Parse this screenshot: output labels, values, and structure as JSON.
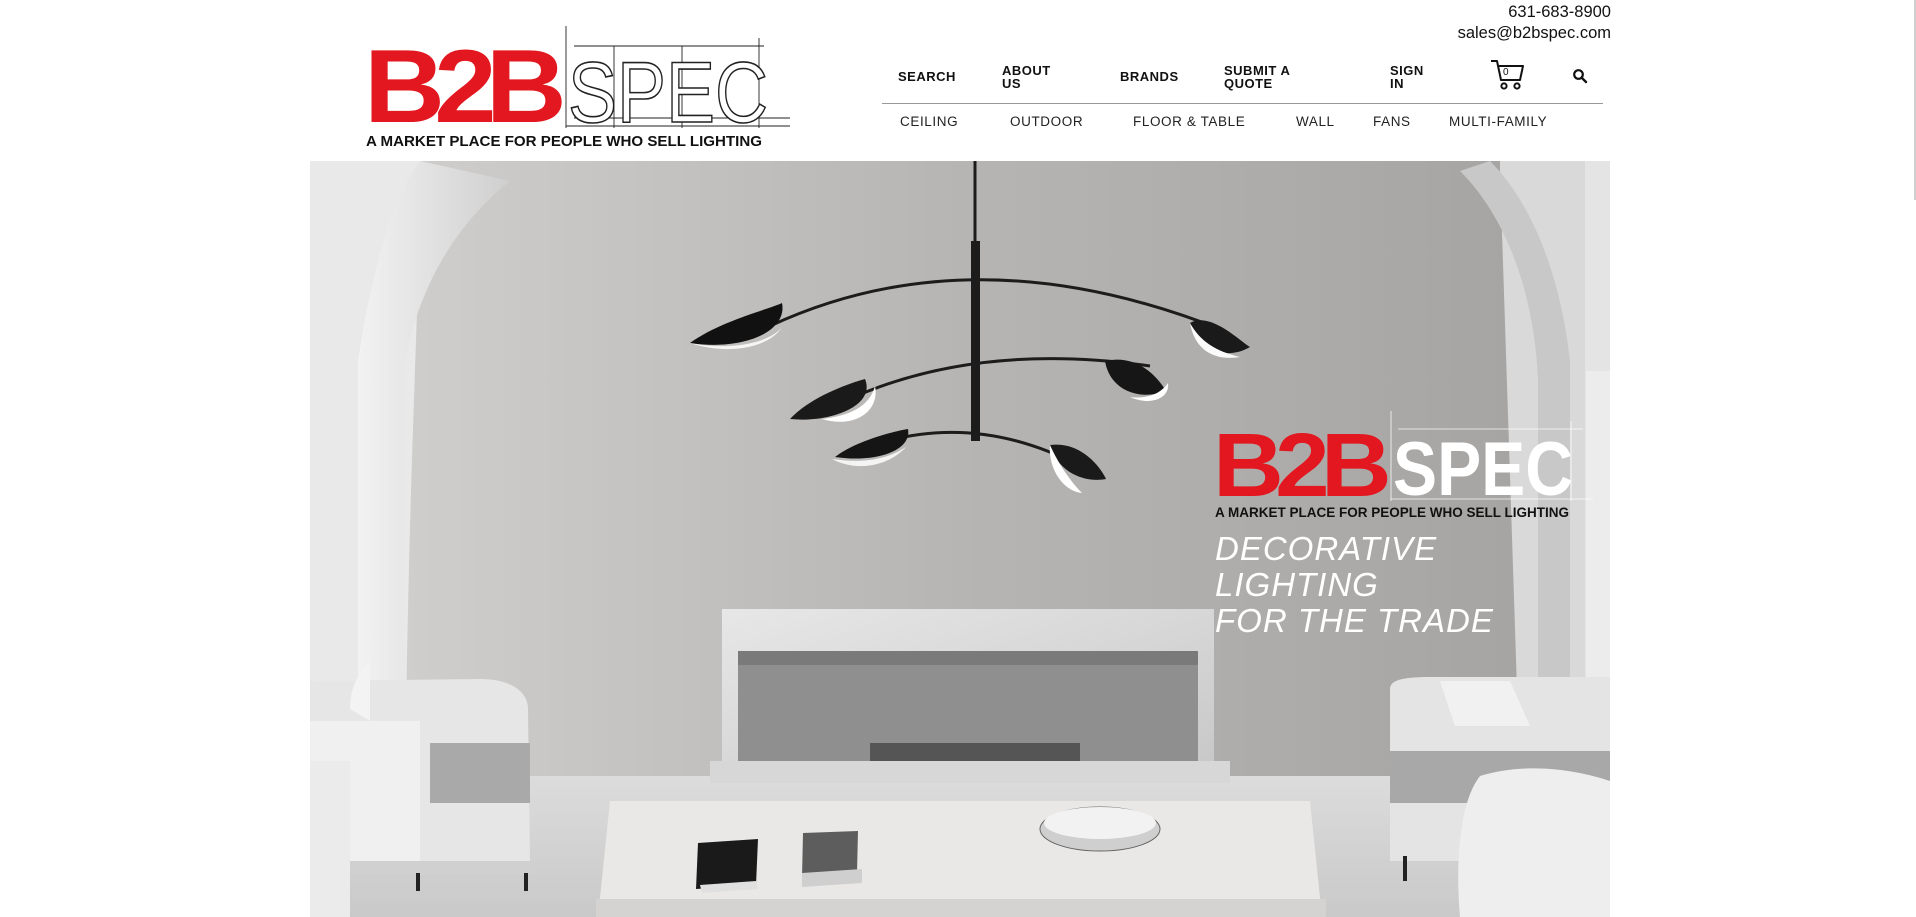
{
  "contact": {
    "phone": "631-683-8900",
    "email": "sales@b2bspec.com"
  },
  "logo": {
    "brand_left": "B2B",
    "brand_right": "SPEC",
    "tagline": "A MARKET PLACE FOR PEOPLE WHO SELL LIGHTING"
  },
  "nav": {
    "top": [
      {
        "label": "SEARCH"
      },
      {
        "label": "ABOUT\nUS"
      },
      {
        "label": "BRANDS"
      },
      {
        "label": "SUBMIT A\nQUOTE"
      },
      {
        "label": "SIGN\nIN"
      }
    ],
    "cart_count": "0",
    "categories": [
      {
        "label": "CEILING"
      },
      {
        "label": "OUTDOOR"
      },
      {
        "label": "FLOOR & TABLE"
      },
      {
        "label": "WALL"
      },
      {
        "label": "FANS"
      },
      {
        "label": "MULTI-FAMILY"
      }
    ]
  },
  "hero": {
    "brand_left": "B2B",
    "brand_right": "SPEC",
    "tagline": "A MARKET PLACE FOR PEOPLE WHO SELL LIGHTING",
    "headline": "DECORATIVE LIGHTING\nFOR THE TRADE"
  },
  "colors": {
    "brand_red": "#e3171f",
    "wall_gray": "#b9b7b5",
    "text": "#111111"
  },
  "icons": {
    "cart": "shopping-cart-icon",
    "search": "search-icon"
  }
}
